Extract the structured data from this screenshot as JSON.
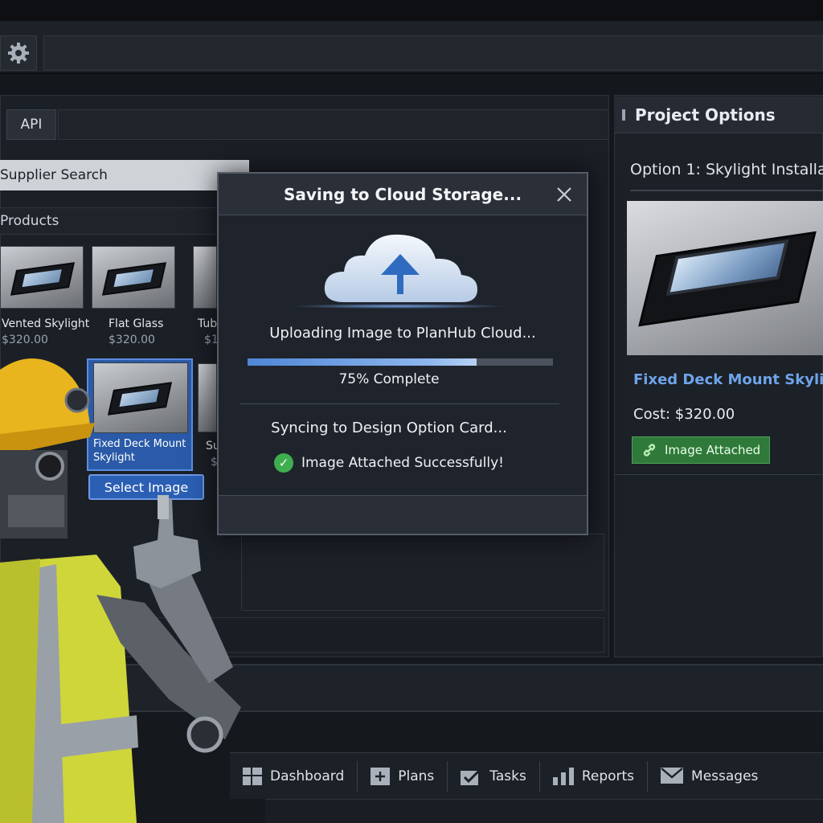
{
  "toolbar": {
    "settings_icon": "gear-icon"
  },
  "left": {
    "tab_api": "API",
    "search_label": "Supplier Search",
    "products_heading": "Products",
    "products": [
      {
        "name": "Vented Skylight",
        "price": "$320.00"
      },
      {
        "name": "Flat Glass",
        "price": "$320.00"
      },
      {
        "name": "Tub",
        "price": "$1"
      }
    ],
    "selected_product": {
      "name": "Fixed Deck Mount Skylight",
      "partial_next_name": "Su",
      "partial_next_price": "$"
    },
    "select_button": "Select Image"
  },
  "modal": {
    "title": "Saving to Cloud Storage...",
    "close_icon": "close-icon",
    "upload_text": "Uploading Image to PlanHub Cloud...",
    "progress": 0.75,
    "progress_label": "75% Complete",
    "sync_text": "Syncing to Design Option Card...",
    "success_text": "Image Attached Successfully!"
  },
  "right": {
    "heading": "Project Options",
    "option_title": "Option 1: Skylight Installa",
    "product_title": "Fixed Deck Mount Skylight",
    "cost": "Cost: $320.00",
    "attached_badge": "Image Attached"
  },
  "nav": {
    "items": [
      {
        "label": "Dashboard",
        "icon": "dashboard-icon"
      },
      {
        "label": "Plans",
        "icon": "plans-icon"
      },
      {
        "label": "Tasks",
        "icon": "tasks-icon"
      },
      {
        "label": "Reports",
        "icon": "reports-icon"
      },
      {
        "label": "Messages",
        "icon": "messages-icon"
      }
    ]
  },
  "colors": {
    "accent": "#2b5fb3",
    "link": "#6ea4ea",
    "success": "#2f7a3a"
  }
}
